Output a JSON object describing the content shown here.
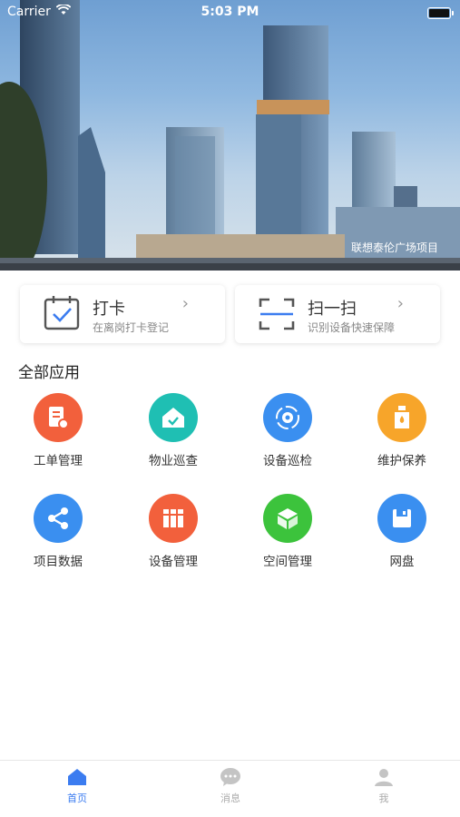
{
  "status_bar": {
    "carrier": "Carrier",
    "time": "5:03 PM"
  },
  "banner": {
    "caption": "联想泰伦广场项目"
  },
  "quick_actions": [
    {
      "title": "打卡",
      "subtitle": "在离岗打卡登记",
      "icon": "calendar-check-icon"
    },
    {
      "title": "扫一扫",
      "subtitle": "识别设备快速保障",
      "icon": "scan-icon"
    }
  ],
  "section": {
    "title": "全部应用"
  },
  "apps": [
    {
      "label": "工单管理",
      "icon": "work-order-icon",
      "color": "#f2603c"
    },
    {
      "label": "物业巡查",
      "icon": "house-check-icon",
      "color": "#1fbfb3"
    },
    {
      "label": "设备巡检",
      "icon": "gear-cycle-icon",
      "color": "#3a8ff0"
    },
    {
      "label": "维护保养",
      "icon": "oil-bottle-icon",
      "color": "#f7a52a"
    },
    {
      "label": "项目数据",
      "icon": "share-nodes-icon",
      "color": "#3a8ff0"
    },
    {
      "label": "设备管理",
      "icon": "binders-icon",
      "color": "#f2603c"
    },
    {
      "label": "空间管理",
      "icon": "cube-icon",
      "color": "#3cc33c"
    },
    {
      "label": "网盘",
      "icon": "floppy-disk-icon",
      "color": "#3a8ff0"
    }
  ],
  "tabbar": [
    {
      "label": "首页",
      "icon": "home-icon",
      "active": true
    },
    {
      "label": "消息",
      "icon": "chat-icon",
      "active": false
    },
    {
      "label": "我",
      "icon": "person-icon",
      "active": false
    }
  ]
}
